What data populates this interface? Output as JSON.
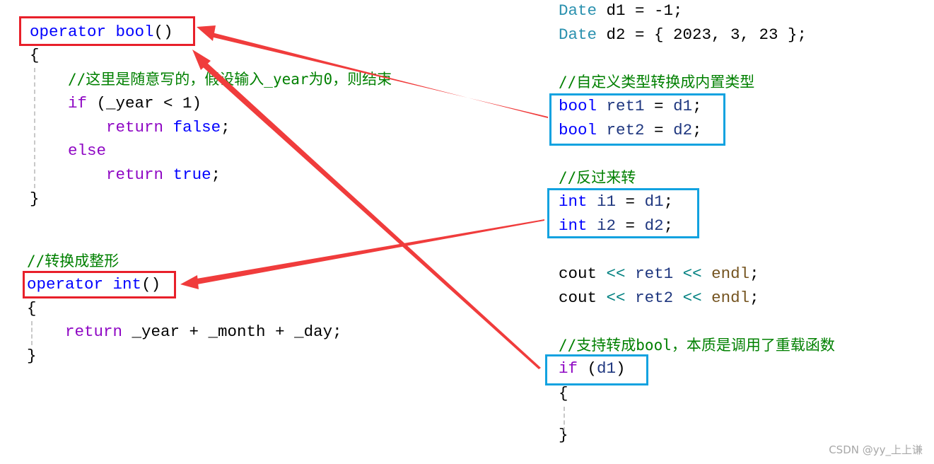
{
  "left_code": [
    {
      "id": "l1",
      "tokens": [
        [
          "operator",
          "kw"
        ],
        [
          " ",
          "plain"
        ],
        [
          "bool",
          "kw"
        ],
        [
          "()",
          "plain"
        ]
      ]
    },
    {
      "id": "l2",
      "tokens": [
        [
          "{",
          "plain"
        ]
      ]
    },
    {
      "id": "l3",
      "tokens": [
        [
          "    ",
          "plain"
        ],
        [
          "//这里是随意写的，假设输入_year为0，则结束",
          "cmt"
        ]
      ]
    },
    {
      "id": "l4",
      "tokens": [
        [
          "    ",
          "plain"
        ],
        [
          "if",
          "ctl"
        ],
        [
          " (_year < 1)",
          "plain"
        ]
      ]
    },
    {
      "id": "l5",
      "tokens": [
        [
          "        ",
          "plain"
        ],
        [
          "return",
          "ctl"
        ],
        [
          " ",
          "plain"
        ],
        [
          "false",
          "kw"
        ],
        [
          ";",
          "plain"
        ]
      ]
    },
    {
      "id": "l6",
      "tokens": [
        [
          "    ",
          "plain"
        ],
        [
          "else",
          "ctl"
        ]
      ]
    },
    {
      "id": "l7",
      "tokens": [
        [
          "        ",
          "plain"
        ],
        [
          "return",
          "ctl"
        ],
        [
          " ",
          "plain"
        ],
        [
          "true",
          "kw"
        ],
        [
          ";",
          "plain"
        ]
      ]
    },
    {
      "id": "l8",
      "tokens": [
        [
          "}",
          "plain"
        ]
      ]
    },
    {
      "id": "l9",
      "tokens": [
        [
          "//转换成整形",
          "cmt"
        ]
      ]
    },
    {
      "id": "l10",
      "tokens": [
        [
          "operator",
          "kw"
        ],
        [
          " ",
          "plain"
        ],
        [
          "int",
          "kw"
        ],
        [
          "()",
          "plain"
        ]
      ]
    },
    {
      "id": "l11",
      "tokens": [
        [
          "{",
          "plain"
        ]
      ]
    },
    {
      "id": "l12",
      "tokens": [
        [
          "    ",
          "plain"
        ],
        [
          "return",
          "ctl"
        ],
        [
          " _year + _month + _day;",
          "plain"
        ]
      ]
    },
    {
      "id": "l13",
      "tokens": [
        [
          "}",
          "plain"
        ]
      ]
    }
  ],
  "right_code": [
    {
      "id": "r1",
      "tokens": [
        [
          "Date",
          "type"
        ],
        [
          " d1 = -1;",
          "plain"
        ]
      ]
    },
    {
      "id": "r2",
      "tokens": [
        [
          "Date",
          "type"
        ],
        [
          " d2 = { 2023, 3, 23 };",
          "plain"
        ]
      ]
    },
    {
      "id": "r3",
      "tokens": [
        [
          "//自定义类型转换成内置类型",
          "cmt"
        ]
      ]
    },
    {
      "id": "r4",
      "tokens": [
        [
          "bool",
          "kw"
        ],
        [
          " ",
          "plain"
        ],
        [
          "ret1",
          "var"
        ],
        [
          " = ",
          "plain"
        ],
        [
          "d1",
          "var"
        ],
        [
          ";",
          "plain"
        ]
      ]
    },
    {
      "id": "r5",
      "tokens": [
        [
          "bool",
          "kw"
        ],
        [
          " ",
          "plain"
        ],
        [
          "ret2",
          "var"
        ],
        [
          " = ",
          "plain"
        ],
        [
          "d2",
          "var"
        ],
        [
          ";",
          "plain"
        ]
      ]
    },
    {
      "id": "r6",
      "tokens": [
        [
          "//反过来转",
          "cmt"
        ]
      ]
    },
    {
      "id": "r7",
      "tokens": [
        [
          "int",
          "kw"
        ],
        [
          " ",
          "plain"
        ],
        [
          "i1",
          "var"
        ],
        [
          " = ",
          "plain"
        ],
        [
          "d1",
          "var"
        ],
        [
          ";",
          "plain"
        ]
      ]
    },
    {
      "id": "r8",
      "tokens": [
        [
          "int",
          "kw"
        ],
        [
          " ",
          "plain"
        ],
        [
          "i2",
          "var"
        ],
        [
          " = ",
          "plain"
        ],
        [
          "d2",
          "var"
        ],
        [
          ";",
          "plain"
        ]
      ]
    },
    {
      "id": "r9",
      "tokens": [
        [
          "cout",
          "plain"
        ],
        [
          " ",
          "plain"
        ],
        [
          "<<",
          "op"
        ],
        [
          " ",
          "plain"
        ],
        [
          "ret1",
          "var"
        ],
        [
          " ",
          "plain"
        ],
        [
          "<<",
          "op"
        ],
        [
          " ",
          "plain"
        ],
        [
          "endl",
          "fn"
        ],
        [
          ";",
          "plain"
        ]
      ]
    },
    {
      "id": "r10",
      "tokens": [
        [
          "cout",
          "plain"
        ],
        [
          " ",
          "plain"
        ],
        [
          "<<",
          "op"
        ],
        [
          " ",
          "plain"
        ],
        [
          "ret2",
          "var"
        ],
        [
          " ",
          "plain"
        ],
        [
          "<<",
          "op"
        ],
        [
          " ",
          "plain"
        ],
        [
          "endl",
          "fn"
        ],
        [
          ";",
          "plain"
        ]
      ]
    },
    {
      "id": "r11",
      "tokens": [
        [
          "//支持转成bool，本质是调用了重载函数",
          "cmt"
        ]
      ]
    },
    {
      "id": "r12",
      "tokens": [
        [
          "if",
          "ctl"
        ],
        [
          " (",
          "plain"
        ],
        [
          "d1",
          "var"
        ],
        [
          ")",
          "plain"
        ]
      ]
    },
    {
      "id": "r13",
      "tokens": [
        [
          "{",
          "plain"
        ]
      ]
    },
    {
      "id": "r14",
      "tokens": [
        [
          "}",
          "plain"
        ]
      ]
    }
  ],
  "colors": {
    "highlight_red": "#e8202a",
    "highlight_blue": "#12a2e0",
    "arrow": "#f03c3c"
  },
  "watermark": "CSDN @yy_上上谦"
}
